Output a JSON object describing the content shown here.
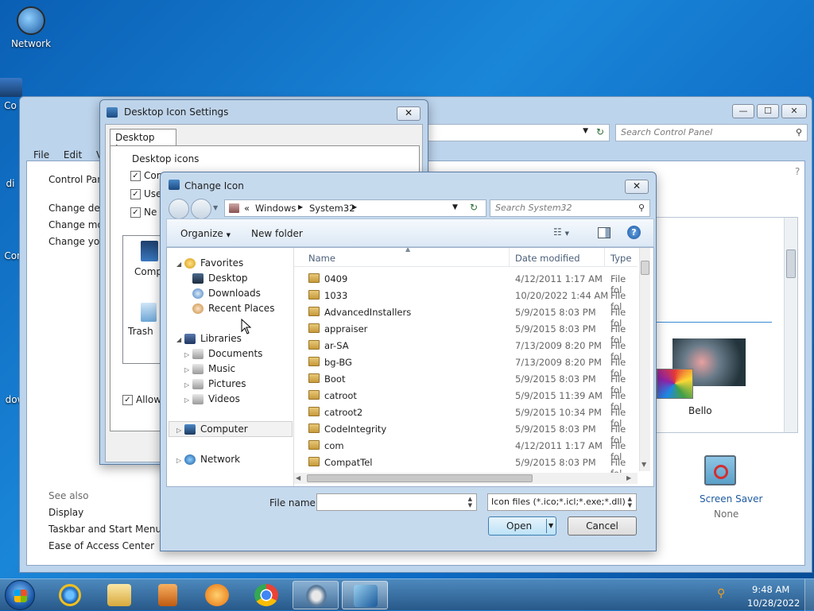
{
  "desktop": {
    "icons": [
      {
        "label": "Network"
      },
      {
        "label": "Co"
      },
      {
        "label": "di"
      },
      {
        "label": "Con"
      },
      {
        "label": "dow"
      }
    ]
  },
  "control_panel": {
    "search_placeholder": "Search Control Panel",
    "menu": [
      "File",
      "Edit",
      "Vi"
    ],
    "sidebar_title": "Control Pane",
    "sidebar_links": [
      "Change desk",
      "Change mou",
      "Change your"
    ],
    "see_also_heading": "See also",
    "see_also": [
      "Display",
      "Taskbar and Start Menu",
      "Ease of Access Center"
    ],
    "theme_label": "Bello",
    "screen_saver_label": "Screen Saver",
    "screen_saver_value": "None",
    "window_buttons": {
      "minimize": "—",
      "maximize": "☐",
      "close": "✕"
    }
  },
  "desktop_icon_settings": {
    "title": "Desktop Icon Settings",
    "tab": "Desktop Icons",
    "group_label": "Desktop icons",
    "checkboxes": [
      {
        "label": "Com",
        "checked": true
      },
      {
        "label": "Use",
        "checked": true
      },
      {
        "label": "Ne",
        "checked": true
      }
    ],
    "preview_icons": [
      "Comp",
      "Trash"
    ],
    "allow_label": "Allow",
    "close": "✕"
  },
  "change_icon": {
    "title": "Change Icon",
    "close": "✕",
    "breadcrumb": {
      "prefix": "«",
      "segments": [
        "Windows",
        "System32"
      ]
    },
    "search_placeholder": "Search System32",
    "toolbar": {
      "organize": "Organize",
      "new_folder": "New folder"
    },
    "tree": {
      "favorites": "Favorites",
      "favorite_items": [
        "Desktop",
        "Downloads",
        "Recent Places"
      ],
      "libraries": "Libraries",
      "library_items": [
        "Documents",
        "Music",
        "Pictures",
        "Videos"
      ],
      "computer": "Computer",
      "network": "Network"
    },
    "columns": {
      "name": "Name",
      "date": "Date modified",
      "type": "Type"
    },
    "files": [
      {
        "name": "0409",
        "date": "4/12/2011 1:17 AM",
        "type": "File fol"
      },
      {
        "name": "1033",
        "date": "10/20/2022 1:44 AM",
        "type": "File fol"
      },
      {
        "name": "AdvancedInstallers",
        "date": "5/9/2015 8:03 PM",
        "type": "File fol"
      },
      {
        "name": "appraiser",
        "date": "5/9/2015 8:03 PM",
        "type": "File fol"
      },
      {
        "name": "ar-SA",
        "date": "7/13/2009 8:20 PM",
        "type": "File fol"
      },
      {
        "name": "bg-BG",
        "date": "7/13/2009 8:20 PM",
        "type": "File fol"
      },
      {
        "name": "Boot",
        "date": "5/9/2015 8:03 PM",
        "type": "File fol"
      },
      {
        "name": "catroot",
        "date": "5/9/2015 11:39 AM",
        "type": "File fol"
      },
      {
        "name": "catroot2",
        "date": "5/9/2015 10:34 PM",
        "type": "File fol"
      },
      {
        "name": "CodeIntegrity",
        "date": "5/9/2015 8:03 PM",
        "type": "File fol"
      },
      {
        "name": "com",
        "date": "4/12/2011 1:17 AM",
        "type": "File fol"
      },
      {
        "name": "CompatTel",
        "date": "5/9/2015 8:03 PM",
        "type": "File fol"
      }
    ],
    "file_name_label": "File name:",
    "file_name_value": "",
    "file_type": "Icon files (*.ico;*.icl;*.exe;*.dll)",
    "open_button": "Open",
    "cancel_button": "Cancel"
  },
  "taskbar": {
    "time": "9:48 AM",
    "date": "10/28/2022"
  }
}
